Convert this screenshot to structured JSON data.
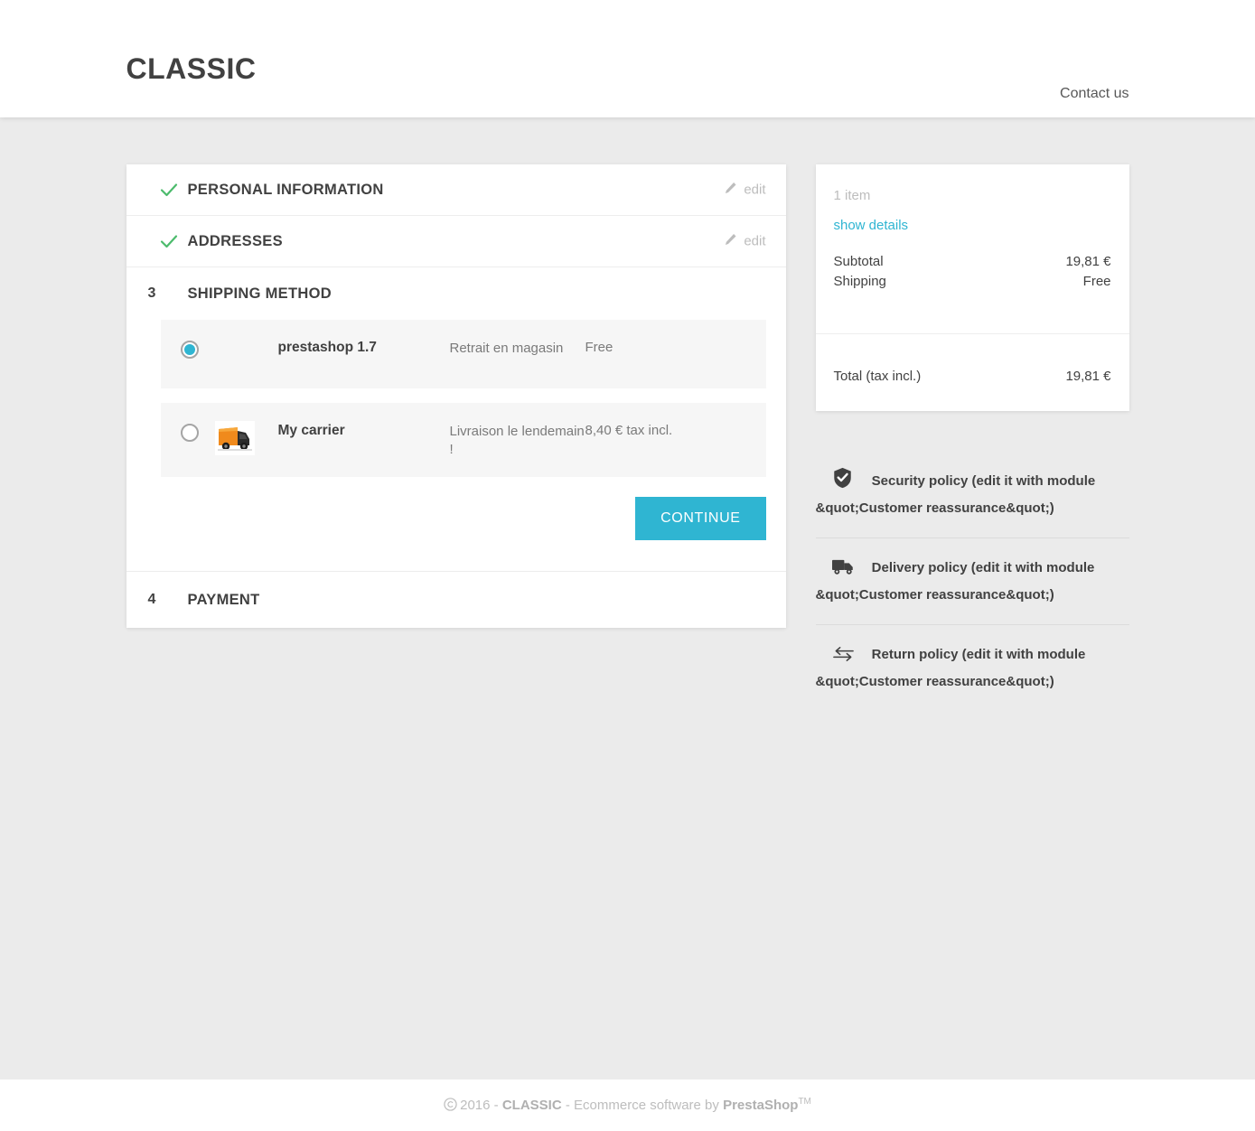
{
  "header": {
    "brand": "CLASSIC",
    "contact_label": "Contact us"
  },
  "checkout": {
    "steps": [
      {
        "id": "personal-information",
        "number": "",
        "title": "PERSONAL INFORMATION",
        "state": "completed",
        "edit_label": "edit"
      },
      {
        "id": "addresses",
        "number": "",
        "title": "ADDRESSES",
        "state": "completed",
        "edit_label": "edit"
      },
      {
        "id": "shipping-method",
        "number": "3",
        "title": "SHIPPING METHOD",
        "state": "active"
      },
      {
        "id": "payment",
        "number": "4",
        "title": "PAYMENT",
        "state": "pending"
      }
    ],
    "delivery_options": [
      {
        "name": "prestashop 1.7",
        "delay": "Retrait en magasin",
        "price": "Free",
        "selected": true,
        "has_logo": false
      },
      {
        "name": "My carrier",
        "delay": "Livraison le lendemain !",
        "price": "8,40 € tax incl.",
        "selected": false,
        "has_logo": true,
        "logo_icon": "orange-truck-image"
      }
    ],
    "continue_label": "Continue"
  },
  "cart_summary": {
    "item_count": "1 item",
    "show_details_label": "show details",
    "lines": [
      {
        "label": "Subtotal",
        "amount": "19,81 €"
      },
      {
        "label": "Shipping",
        "amount": "Free"
      }
    ],
    "total_label": "Total (tax incl.)",
    "total_amount": "19,81 €"
  },
  "reassurance": [
    {
      "icon": "shield-check-icon",
      "text": "Security policy (edit it with module &quot;Customer reassurance&quot;)"
    },
    {
      "icon": "delivery-truck-icon",
      "text": "Delivery policy (edit it with module &quot;Customer reassurance&quot;)"
    },
    {
      "icon": "return-arrows-icon",
      "text": "Return policy (edit it with module &quot;Customer reassurance&quot;)"
    }
  ],
  "footer": {
    "year": "2016",
    "separator_left": " - ",
    "shop_name": "CLASSIC",
    "separator_right": " - ",
    "software_text": "Ecommerce software by ",
    "platform": "PrestaShop",
    "trademark": "TM"
  },
  "colors": {
    "accent": "#2fb5d2",
    "success": "#4cbb6c",
    "page_bg": "#ebebeb",
    "text_dark": "#414141",
    "text_muted": "#7a7a7a"
  }
}
